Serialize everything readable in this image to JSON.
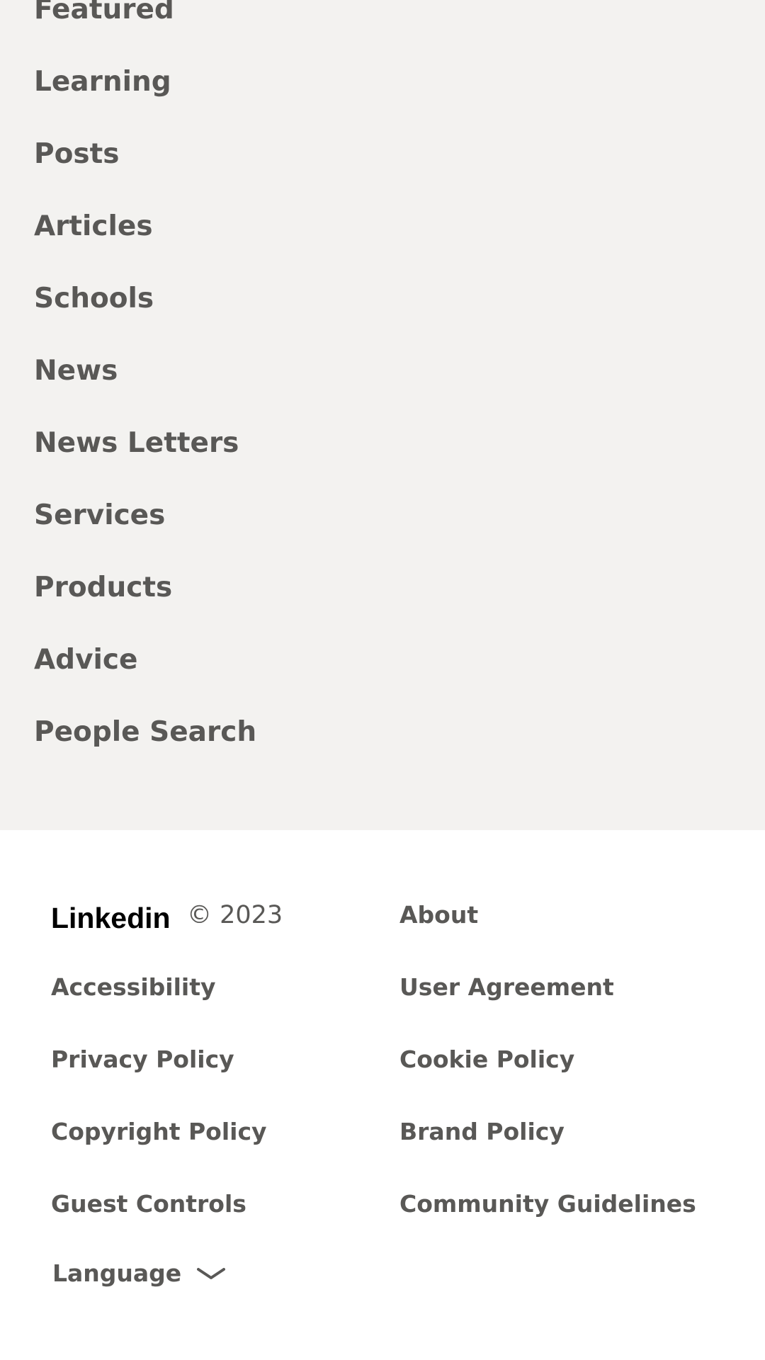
{
  "nav": {
    "items": [
      {
        "label": "Featured"
      },
      {
        "label": "Learning"
      },
      {
        "label": "Posts"
      },
      {
        "label": "Articles"
      },
      {
        "label": "Schools"
      },
      {
        "label": "News"
      },
      {
        "label": "News Letters"
      },
      {
        "label": "Services"
      },
      {
        "label": "Products"
      },
      {
        "label": "Advice"
      },
      {
        "label": "People Search"
      }
    ]
  },
  "footer": {
    "logo_text": "Linkedin",
    "copyright": "© 2023",
    "links_left": [
      {
        "label": "Accessibility"
      },
      {
        "label": "Privacy Policy"
      },
      {
        "label": "Copyright Policy"
      },
      {
        "label": "Guest Controls"
      }
    ],
    "links_right": [
      {
        "label": "About"
      },
      {
        "label": "User Agreement"
      },
      {
        "label": "Cookie Policy"
      },
      {
        "label": "Brand Policy"
      },
      {
        "label": "Community Guidelines"
      }
    ],
    "language": {
      "label": "Language",
      "icon": "chevron-down-icon"
    }
  },
  "colors": {
    "nav_background": "#f3f2f0",
    "text": "#595856",
    "logo": "#000000"
  }
}
